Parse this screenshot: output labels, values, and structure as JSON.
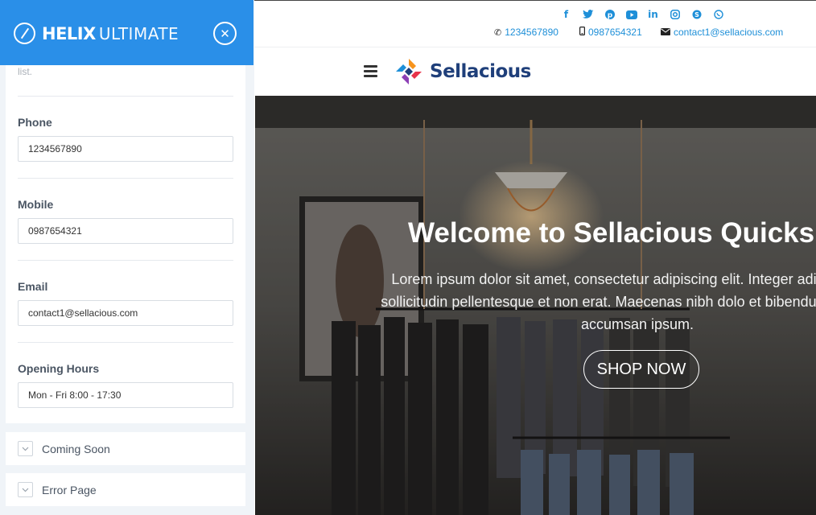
{
  "panel": {
    "logo_bold": "HELIX",
    "logo_light": "ULTIMATE",
    "close_icon": "close-icon",
    "hint_text": "list.",
    "fields": [
      {
        "label": "Phone",
        "value": "1234567890"
      },
      {
        "label": "Mobile",
        "value": "0987654321"
      },
      {
        "label": "Email",
        "value": "contact1@sellacious.com"
      },
      {
        "label": "Opening Hours",
        "value": "Mon - Fri 8:00 - 17:30"
      }
    ],
    "accordions": [
      {
        "label": "Coming Soon",
        "icon": "chevron-down-icon"
      },
      {
        "label": "Error Page",
        "icon": "chevron-down-icon"
      }
    ],
    "accent_color": "#2a8fe8"
  },
  "site": {
    "social_icons": [
      "facebook-icon",
      "twitter-icon",
      "pinterest-icon",
      "youtube-icon",
      "linkedin-icon",
      "instagram-icon",
      "skype-icon",
      "whatsapp-icon"
    ],
    "phone": "1234567890",
    "mobile": "0987654321",
    "email": "contact1@sellacious.com",
    "brand_name": "Sellacious",
    "hero_title": "Welcome to Sellacious Quicks",
    "hero_text": "Lorem ipsum dolor sit amet, consectetur adipiscing elit. Integer adi eget risus sollicitudin pellentesque et non erat. Maecenas nibh dolo et bibendum a, sagittis accumsan ipsum.",
    "shop_button": "SHOP NOW",
    "link_color": "#1e8fd8"
  }
}
